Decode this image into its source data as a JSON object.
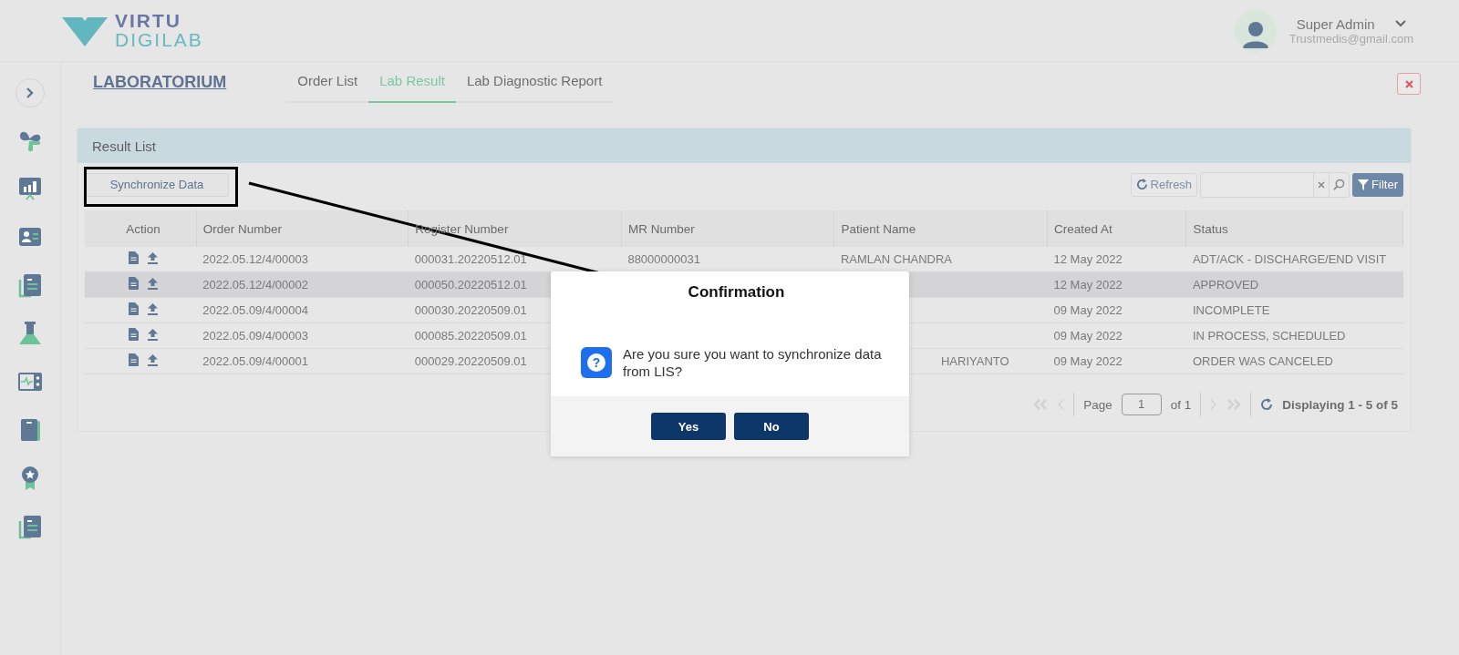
{
  "logo": {
    "line1": "VIRTU",
    "line2": "DIGILAB"
  },
  "user": {
    "name": "Super Admin",
    "email": "Trustmedis@gmail.com"
  },
  "sidebar": {
    "items": [
      {
        "kind": "toggle"
      },
      {
        "kind": "plus"
      },
      {
        "kind": "chart"
      },
      {
        "kind": "card"
      },
      {
        "kind": "doc"
      },
      {
        "kind": "flask"
      },
      {
        "kind": "monitor"
      },
      {
        "kind": "folder"
      },
      {
        "kind": "badge"
      },
      {
        "kind": "doc"
      }
    ]
  },
  "module_title": "LABORATORIUM",
  "tabs": [
    {
      "label": "Order List",
      "selected": false
    },
    {
      "label": "Lab Result",
      "selected": true
    },
    {
      "label": "Lab Diagnostic Report",
      "selected": false
    }
  ],
  "panel": {
    "title": "Result List",
    "sync_button": "Synchronize Data",
    "refresh_button": "Refresh",
    "filter_button": "Filter"
  },
  "table": {
    "columns": [
      "Action",
      "Order Number",
      "Register Number",
      "MR Number",
      "Patient Name",
      "Created At",
      "Status"
    ],
    "rows": [
      {
        "selected": false,
        "order": "2022.05.12/4/00003",
        "register": "000031.20220512.01",
        "mr": "88000000031",
        "patient": "RAMLAN CHANDRA",
        "created": "12 May 2022",
        "status": "ADT/ACK - DISCHARGE/END VISIT"
      },
      {
        "selected": true,
        "order": "2022.05.12/4/00002",
        "register": "000050.20220512.01",
        "created": "12 May 2022",
        "status": "APPROVED"
      },
      {
        "selected": false,
        "order": "2022.05.09/4/00004",
        "register": "000030.20220509.01",
        "created": "09 May 2022",
        "status": "INCOMPLETE"
      },
      {
        "selected": false,
        "order": "2022.05.09/4/00003",
        "register": "000085.20220509.01",
        "created": "09 May 2022",
        "status": "IN PROCESS, SCHEDULED"
      },
      {
        "selected": false,
        "order": "2022.05.09/4/00001",
        "register": "000029.20220509.01",
        "patient_tail": "HARIYANTO",
        "created": "09 May 2022",
        "status": "ORDER WAS CANCELED"
      }
    ]
  },
  "pager": {
    "page_label": "Page",
    "page": "1",
    "of": "of 1",
    "display": "Displaying 1 - 5 of 5"
  },
  "dialog": {
    "title": "Confirmation",
    "icon": "?",
    "message": "Are you sure you want to synchronize data from LIS?",
    "buttons": [
      "Yes",
      "No"
    ]
  }
}
